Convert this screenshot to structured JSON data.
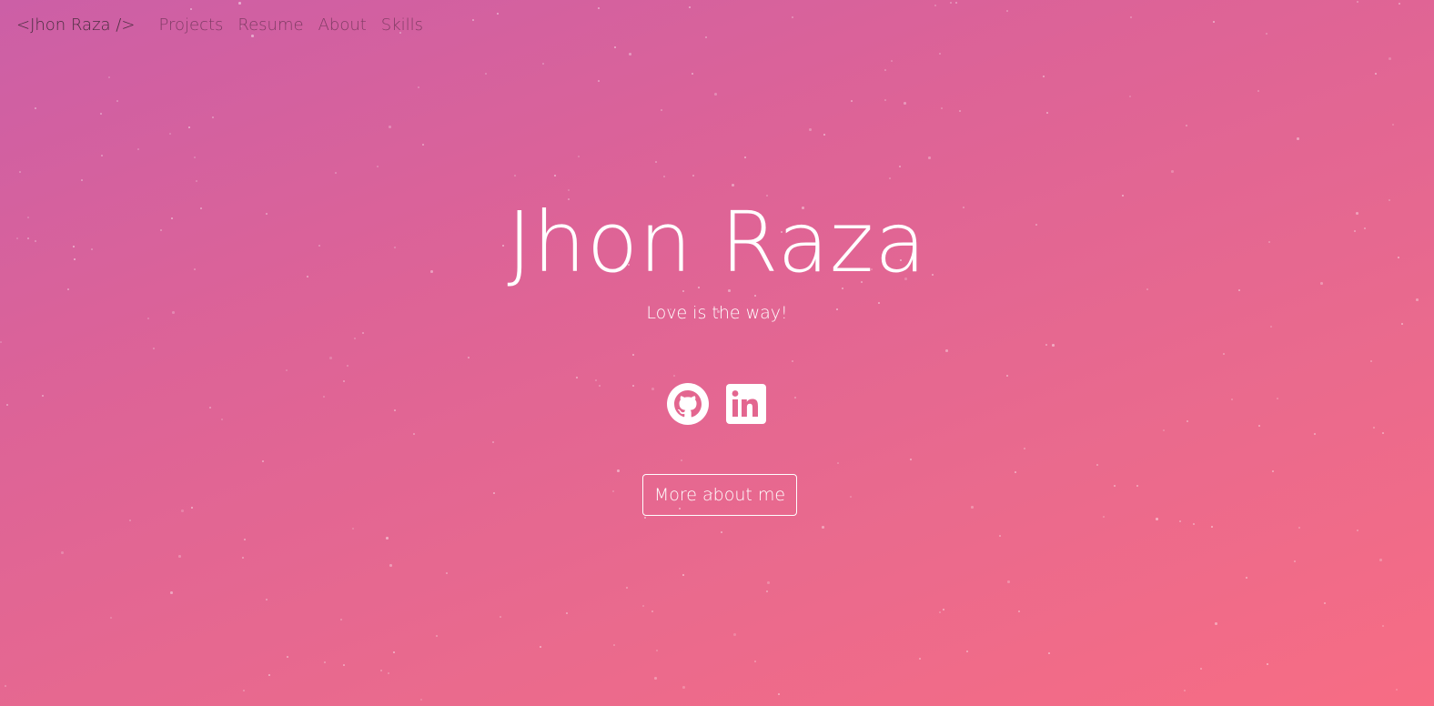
{
  "navbar": {
    "brand": "<Jhon Raza />",
    "links": [
      {
        "label": "Projects"
      },
      {
        "label": "Resume"
      },
      {
        "label": "About"
      },
      {
        "label": "Skills"
      }
    ]
  },
  "hero": {
    "name": "Jhon Raza",
    "tagline": "Love is the way!",
    "cta_label": "More about me"
  },
  "social": [
    {
      "icon": "github-icon"
    },
    {
      "icon": "linkedin-icon"
    }
  ],
  "colors": {
    "gradient_start": "#cc5fa6",
    "gradient_end": "#f76c84",
    "text": "#ffffff",
    "brand_text": "#4a2d3f"
  }
}
